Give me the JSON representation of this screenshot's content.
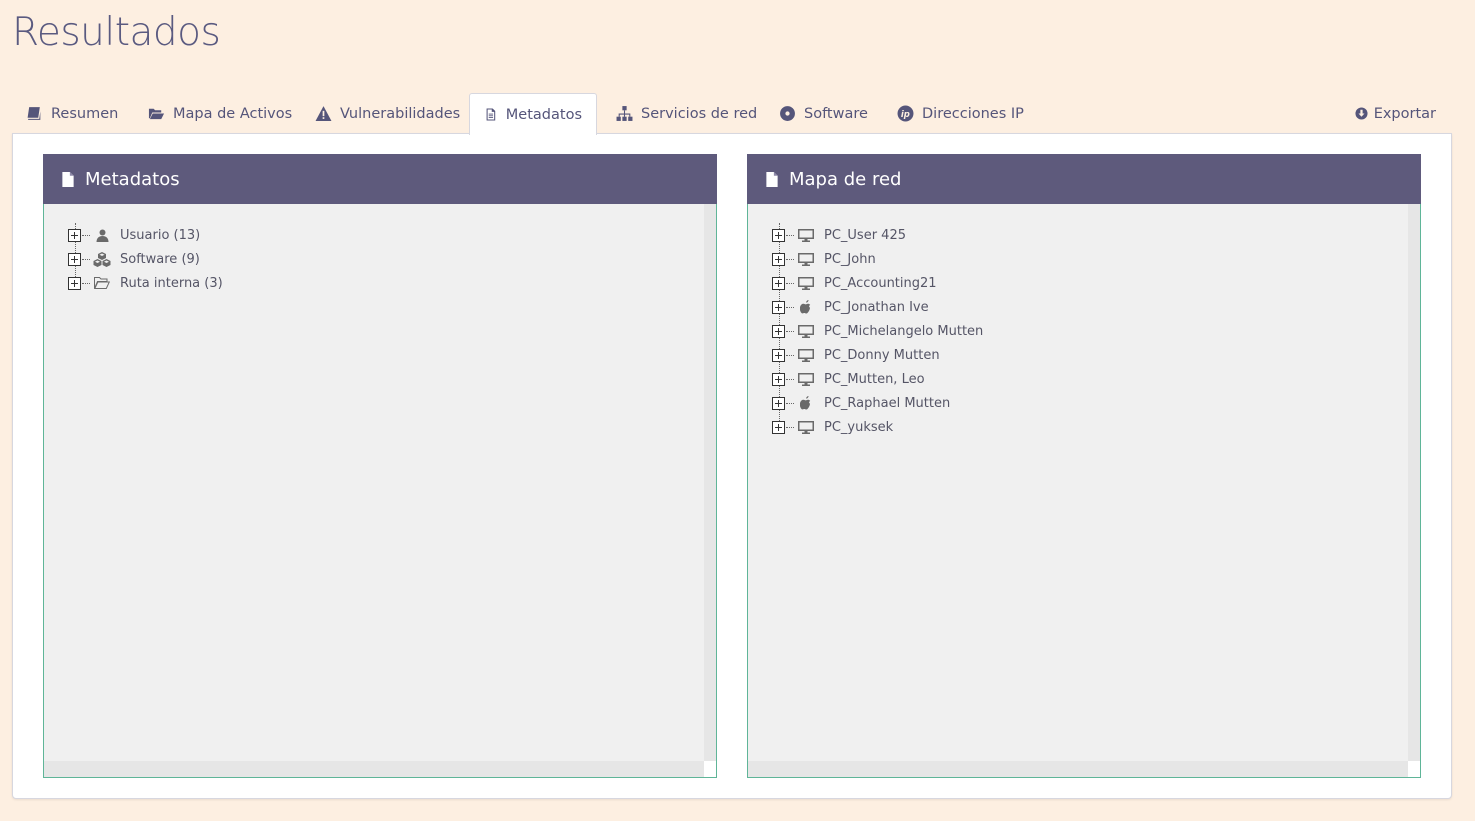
{
  "page": {
    "title": "Resultados"
  },
  "tabs": [
    {
      "label": "Resumen",
      "icon": "book-icon"
    },
    {
      "label": "Mapa de Activos",
      "icon": "folder-open-icon"
    },
    {
      "label": "Vulnerabilidades",
      "icon": "warning-icon"
    },
    {
      "label": "Metadatos",
      "icon": "document-icon",
      "active": true
    },
    {
      "label": "Servicios de red",
      "icon": "sitemap-icon"
    },
    {
      "label": "Software",
      "icon": "disc-icon"
    },
    {
      "label": "Direcciones IP",
      "icon": "ip-icon"
    }
  ],
  "export": {
    "label": "Exportar",
    "icon": "download-circle-icon"
  },
  "metadata_panel": {
    "title": "Metadatos",
    "items": [
      {
        "label": "Usuario (13)",
        "icon": "user-icon"
      },
      {
        "label": "Software (9)",
        "icon": "cubes-icon"
      },
      {
        "label": "Ruta interna (3)",
        "icon": "folder-icon"
      }
    ]
  },
  "network_panel": {
    "title": "Mapa de red",
    "items": [
      {
        "label": "PC_User 425",
        "icon": "desktop-icon"
      },
      {
        "label": "PC_John",
        "icon": "desktop-icon"
      },
      {
        "label": "PC_Accounting21",
        "icon": "desktop-icon"
      },
      {
        "label": "PC_Jonathan Ive",
        "icon": "apple-icon"
      },
      {
        "label": "PC_Michelangelo Mutten",
        "icon": "desktop-icon"
      },
      {
        "label": "PC_Donny Mutten",
        "icon": "desktop-icon"
      },
      {
        "label": "PC_Mutten, Leo",
        "icon": "desktop-icon"
      },
      {
        "label": "PC_Raphael Mutten",
        "icon": "apple-icon"
      },
      {
        "label": "PC_yuksek",
        "icon": "desktop-icon"
      }
    ]
  }
}
